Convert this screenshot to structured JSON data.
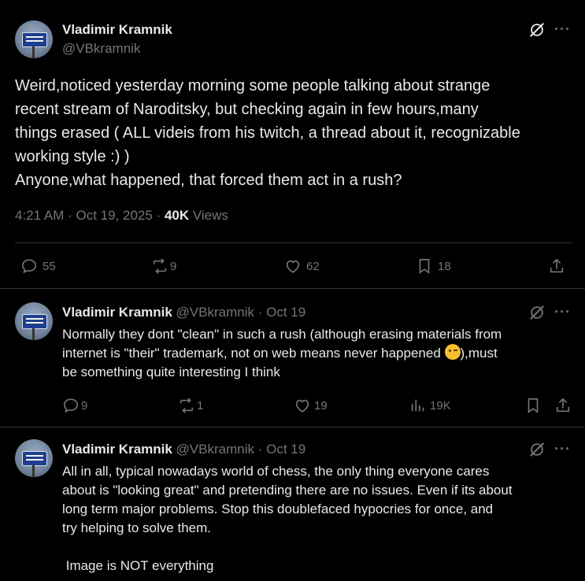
{
  "main_tweet": {
    "author_name": "Vladimir Kramnik",
    "author_handle": "@VBkramnik",
    "more_label": "···",
    "text_lines": [
      "Weird,noticed yesterday morning some people talking about strange",
      "recent stream of Naroditsky, but checking again in few hours,many",
      "things erased ( ALL videis from his twitch, a thread about it, recognizable",
      "working style :) )",
      "Anyone,what happened, that forced them act in a rush?"
    ],
    "time": "4:21 AM · Oct 19, 2025 · ",
    "views_count": "40K",
    "views_label": " Views",
    "replies": "55",
    "reposts": "9",
    "likes": "62",
    "bookmarks": "18"
  },
  "reply1": {
    "author_name": "Vladimir Kramnik",
    "meta": " @VBkramnik · Oct 19",
    "more_label": "···",
    "text_line1": "Normally they dont \"clean\" in such a rush (although erasing materials from",
    "text_line2a": "internet is \"their\" trademark, not on web means never happened ",
    "text_line2b": "),must",
    "text_line3": "be something quite interesting I think",
    "replies": "9",
    "reposts": "1",
    "likes": "19",
    "views": "19K"
  },
  "reply2": {
    "author_name": "Vladimir Kramnik",
    "meta": " @VBkramnik · Oct 19",
    "more_label": "···",
    "text_lines": [
      "All in all, typical nowadays world of chess, the only thing everyone cares",
      "about is \"looking great\" and pretending there are no issues. Even if its about",
      "long term major problems. Stop this doublefaced hypocries for once, and",
      "try helping to solve them.",
      "",
      " Image is NOT everything"
    ]
  },
  "icons": {
    "grok": "grok-icon",
    "reply": "reply-icon",
    "repost": "repost-icon",
    "like": "heart-icon",
    "bookmark": "bookmark-icon",
    "share": "share-icon",
    "views": "analytics-icon",
    "emoji": "winking-face-emoji"
  },
  "colors": {
    "background": "#000000",
    "text": "#e7e9ea",
    "secondary": "#71767b",
    "divider": "#2f3336"
  }
}
